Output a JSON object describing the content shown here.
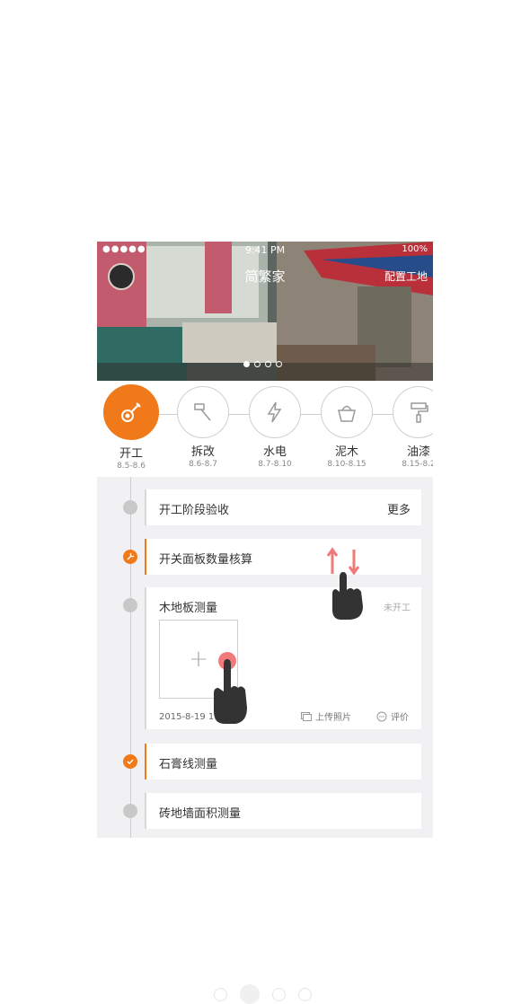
{
  "status": {
    "signal": "●●●●●",
    "time": "9:41 PM",
    "battery": "100%"
  },
  "header": {
    "app_title": "简繁家",
    "config_label": "配置工地"
  },
  "carousel": {
    "count": 4,
    "active": 0
  },
  "stages": [
    {
      "name": "开工",
      "date": "8.5-8.6",
      "icon": "guitar-icon",
      "active": true
    },
    {
      "name": "拆改",
      "date": "8.6-8.7",
      "icon": "hammer-icon",
      "active": false
    },
    {
      "name": "水电",
      "date": "8.7-8.10",
      "icon": "lightning-icon",
      "active": false
    },
    {
      "name": "泥木",
      "date": "8.10-8.15",
      "icon": "bucket-icon",
      "active": false
    },
    {
      "name": "油漆",
      "date": "8.15-8.2",
      "icon": "paint-roller-icon",
      "active": false
    }
  ],
  "tasks": {
    "t1": {
      "title": "开工阶段验收",
      "more": "更多"
    },
    "t2": {
      "title": "开关面板数量核算"
    },
    "t3": {
      "title": "木地板测量",
      "status": "未开工",
      "meta": "2015-8-19  11",
      "upload_label": "上传照片",
      "comment_label": "评价"
    },
    "t4": {
      "title": "石膏线测量"
    },
    "t5": {
      "title": "砖地墙面积测量"
    }
  },
  "colors": {
    "accent": "#f07a19",
    "gesture": "#f07a7a"
  },
  "pager": {
    "count": 4,
    "active": 1
  }
}
